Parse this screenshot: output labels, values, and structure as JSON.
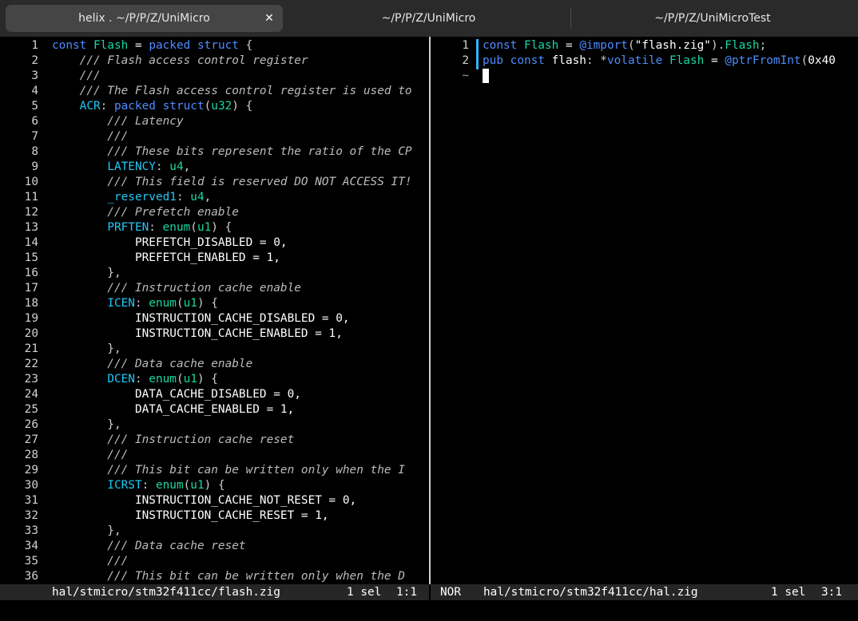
{
  "tabs": [
    {
      "title": "helix . ~/P/P/Z/UniMicro",
      "close": "✕"
    },
    {
      "title": "~/P/P/Z/UniMicro"
    },
    {
      "title": "~/P/P/Z/UniMicroTest"
    }
  ],
  "left_pane": {
    "line_numbers": [
      "1",
      "2",
      "3",
      "4",
      "5",
      "6",
      "7",
      "8",
      "9",
      "10",
      "11",
      "12",
      "13",
      "14",
      "15",
      "16",
      "17",
      "18",
      "19",
      "20",
      "21",
      "22",
      "23",
      "24",
      "25",
      "26",
      "27",
      "28",
      "29",
      "30",
      "31",
      "32",
      "33",
      "34",
      "35",
      "36"
    ],
    "lines": [
      [
        [
          "const ",
          "kw"
        ],
        [
          "Flash",
          "tp"
        ],
        [
          " = ",
          "code"
        ],
        [
          "packed struct",
          "kw"
        ],
        [
          " {",
          "pn"
        ]
      ],
      [
        [
          "    /// Flash access control register",
          "cm"
        ]
      ],
      [
        [
          "    ///",
          "cm"
        ]
      ],
      [
        [
          "    /// The Flash access control register is used to",
          "cm"
        ]
      ],
      [
        [
          "    ",
          "code"
        ],
        [
          "ACR",
          "fld"
        ],
        [
          ": ",
          "pn"
        ],
        [
          "packed struct",
          "kw"
        ],
        [
          "(",
          "pn"
        ],
        [
          "u32",
          "tp"
        ],
        [
          ") {",
          "pn"
        ]
      ],
      [
        [
          "        /// Latency",
          "cm"
        ]
      ],
      [
        [
          "        ///",
          "cm"
        ]
      ],
      [
        [
          "        /// These bits represent the ratio of the CP",
          "cm"
        ]
      ],
      [
        [
          "        ",
          "code"
        ],
        [
          "LATENCY",
          "fld"
        ],
        [
          ": ",
          "pn"
        ],
        [
          "u4",
          "tp"
        ],
        [
          ",",
          "pn"
        ]
      ],
      [
        [
          "        /// This field is reserved DO NOT ACCESS IT!",
          "cm"
        ]
      ],
      [
        [
          "        ",
          "code"
        ],
        [
          "_reserved1",
          "fld"
        ],
        [
          ": ",
          "pn"
        ],
        [
          "u4",
          "tp"
        ],
        [
          ",",
          "pn"
        ]
      ],
      [
        [
          "        /// Prefetch enable",
          "cm"
        ]
      ],
      [
        [
          "        ",
          "code"
        ],
        [
          "PRFTEN",
          "fld"
        ],
        [
          ": ",
          "pn"
        ],
        [
          "enum",
          "tp"
        ],
        [
          "(",
          "pn"
        ],
        [
          "u1",
          "tp"
        ],
        [
          ") {",
          "pn"
        ]
      ],
      [
        [
          "            PREFETCH_DISABLED = 0,",
          "code"
        ]
      ],
      [
        [
          "            PREFETCH_ENABLED = 1,",
          "code"
        ]
      ],
      [
        [
          "        },",
          "pn"
        ]
      ],
      [
        [
          "        /// Instruction cache enable",
          "cm"
        ]
      ],
      [
        [
          "        ",
          "code"
        ],
        [
          "ICEN",
          "fld"
        ],
        [
          ": ",
          "pn"
        ],
        [
          "enum",
          "tp"
        ],
        [
          "(",
          "pn"
        ],
        [
          "u1",
          "tp"
        ],
        [
          ") {",
          "pn"
        ]
      ],
      [
        [
          "            INSTRUCTION_CACHE_DISABLED = 0,",
          "code"
        ]
      ],
      [
        [
          "            INSTRUCTION_CACHE_ENABLED = 1,",
          "code"
        ]
      ],
      [
        [
          "        },",
          "pn"
        ]
      ],
      [
        [
          "        /// Data cache enable",
          "cm"
        ]
      ],
      [
        [
          "        ",
          "code"
        ],
        [
          "DCEN",
          "fld"
        ],
        [
          ": ",
          "pn"
        ],
        [
          "enum",
          "tp"
        ],
        [
          "(",
          "pn"
        ],
        [
          "u1",
          "tp"
        ],
        [
          ") {",
          "pn"
        ]
      ],
      [
        [
          "            DATA_CACHE_DISABLED = 0,",
          "code"
        ]
      ],
      [
        [
          "            DATA_CACHE_ENABLED = 1,",
          "code"
        ]
      ],
      [
        [
          "        },",
          "pn"
        ]
      ],
      [
        [
          "        /// Instruction cache reset",
          "cm"
        ]
      ],
      [
        [
          "        ///",
          "cm"
        ]
      ],
      [
        [
          "        /// This bit can be written only when the I",
          "cm"
        ]
      ],
      [
        [
          "        ",
          "code"
        ],
        [
          "ICRST",
          "fld"
        ],
        [
          ": ",
          "pn"
        ],
        [
          "enum",
          "tp"
        ],
        [
          "(",
          "pn"
        ],
        [
          "u1",
          "tp"
        ],
        [
          ") {",
          "pn"
        ]
      ],
      [
        [
          "            INSTRUCTION_CACHE_NOT_RESET = 0,",
          "code"
        ]
      ],
      [
        [
          "            INSTRUCTION_CACHE_RESET = 1,",
          "code"
        ]
      ],
      [
        [
          "        },",
          "pn"
        ]
      ],
      [
        [
          "        /// Data cache reset",
          "cm"
        ]
      ],
      [
        [
          "        ///",
          "cm"
        ]
      ],
      [
        [
          "        /// This bit can be written only when the D",
          "cm"
        ]
      ]
    ],
    "status": {
      "mode": "",
      "file": "hal/stmicro/stm32f411cc/flash.zig",
      "sel": "1 sel",
      "pos": "1:1"
    }
  },
  "right_pane": {
    "line_numbers": [
      "1",
      "2"
    ],
    "lines": [
      [
        [
          "const ",
          "kw"
        ],
        [
          "Flash",
          "tp"
        ],
        [
          " = ",
          "code"
        ],
        [
          "@import",
          "bi"
        ],
        [
          "(",
          "pn"
        ],
        [
          "\"flash.zig\"",
          "st2"
        ],
        [
          ").",
          "pn"
        ],
        [
          "Flash",
          "tp"
        ],
        [
          ";",
          "pn"
        ]
      ],
      [
        [
          "pub const ",
          "kw"
        ],
        [
          "flash",
          "code"
        ],
        [
          ": *",
          "pn"
        ],
        [
          "volatile ",
          "kw"
        ],
        [
          "Flash",
          "tp"
        ],
        [
          " = ",
          "code"
        ],
        [
          "@ptrFromInt",
          "bi"
        ],
        [
          "(",
          "pn"
        ],
        [
          "0x40",
          "code"
        ]
      ]
    ],
    "tilde": "~",
    "status": {
      "mode": "NOR",
      "file": "hal/stmicro/stm32f411cc/hal.zig",
      "sel": "1 sel",
      "pos": "3:1"
    }
  }
}
